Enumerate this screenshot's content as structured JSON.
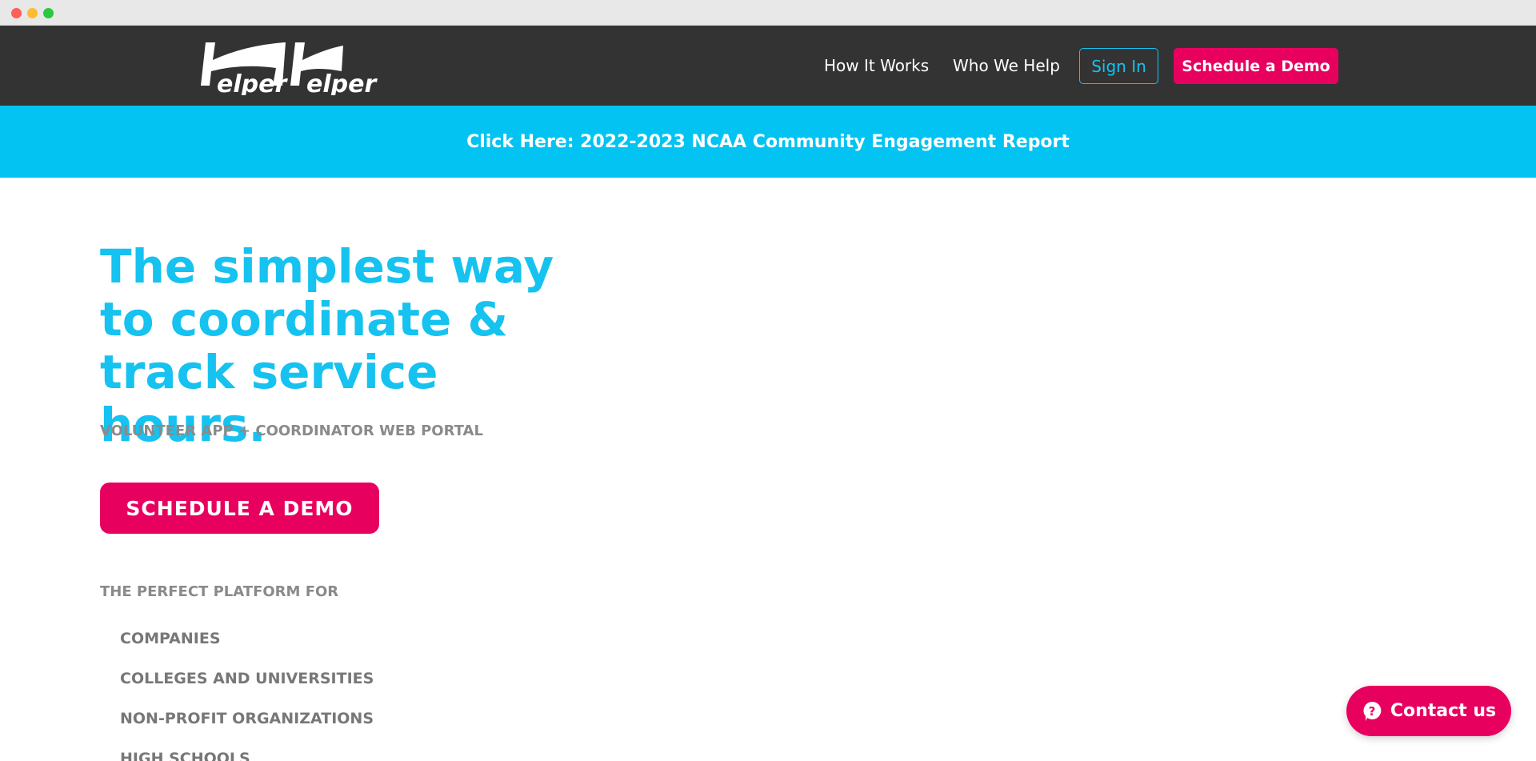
{
  "header": {
    "logo_text": "HelperHelper",
    "nav": {
      "how_it_works": "How It Works",
      "who_we_help": "Who We Help",
      "sign_in": "Sign In",
      "schedule_demo": "Schedule a Demo"
    }
  },
  "banner": {
    "link_text": "Click Here: 2022-2023 NCAA Community Engagement Report"
  },
  "hero": {
    "title": "The simplest way to coordinate & track service hours.",
    "subtitle": "VOLUNTEER APP + COORDINATOR WEB PORTAL",
    "cta_label": "SCHEDULE A DEMO",
    "platform_label": "THE PERFECT PLATFORM FOR",
    "platform_items": [
      "COMPANIES",
      "COLLEGES AND UNIVERSITIES",
      "NON-PROFIT ORGANIZATIONS",
      "HIGH SCHOOLS"
    ]
  },
  "contact": {
    "label": "Contact us",
    "icon": "help-bubble-icon"
  },
  "colors": {
    "header_bg": "#333333",
    "accent_blue": "#02c3f2",
    "accent_pink": "#e8005f"
  }
}
